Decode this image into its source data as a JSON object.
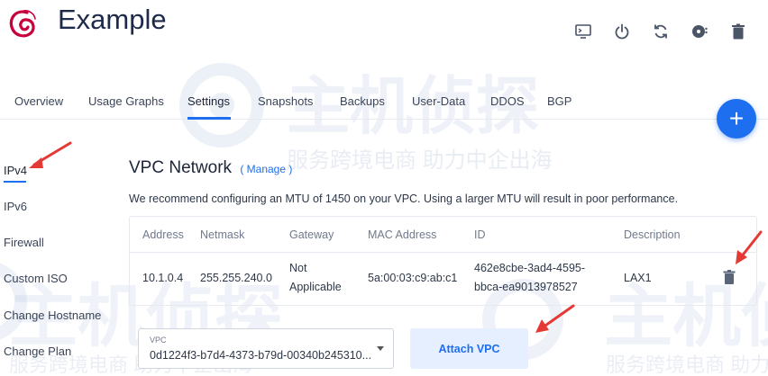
{
  "header": {
    "title": "Example",
    "icons": [
      "console-icon",
      "power-icon",
      "restart-icon",
      "reinstall-icon",
      "trash-icon"
    ]
  },
  "tabs": [
    {
      "label": "Overview"
    },
    {
      "label": "Usage Graphs"
    },
    {
      "label": "Settings",
      "active": true
    },
    {
      "label": "Snapshots"
    },
    {
      "label": "Backups"
    },
    {
      "label": "User-Data"
    },
    {
      "label": "DDOS"
    },
    {
      "label": "BGP"
    }
  ],
  "fab_label": "+",
  "sidebar": {
    "items": [
      {
        "label": "IPv4",
        "active": true
      },
      {
        "label": "IPv6"
      },
      {
        "label": "Firewall"
      },
      {
        "label": "Custom ISO"
      },
      {
        "label": "Change Hostname"
      },
      {
        "label": "Change Plan"
      }
    ]
  },
  "main": {
    "section_title": "VPC Network",
    "manage_link": "( Manage )",
    "note": "We recommend configuring an MTU of 1450 on your VPC. Using a larger MTU will result in poor performance.",
    "table": {
      "columns": [
        "Address",
        "Netmask",
        "Gateway",
        "MAC Address",
        "ID",
        "Description"
      ],
      "rows": [
        {
          "address": "10.1.0.4",
          "netmask": "255.255.240.0",
          "gateway_line1": "Not",
          "gateway_line2": "Applicable",
          "mac": "5a:00:03:c9:ab:c1",
          "id_line1": "462e8cbe-3ad4-4595-",
          "id_line2": "bbca-ea9013978527",
          "description": "LAX1"
        }
      ]
    },
    "vpc_select": {
      "label": "VPC",
      "value": "0d1224f3-b7d4-4373-b79d-00340b245310..."
    },
    "attach_button": "Attach VPC"
  },
  "watermark": {
    "brand": "主机侦探",
    "slogan": "服务跨境电商 助力中企出海"
  },
  "colors": {
    "accent": "#1e6ff0",
    "annotation_arrow": "#e53935",
    "title": "#1e2a4a"
  }
}
